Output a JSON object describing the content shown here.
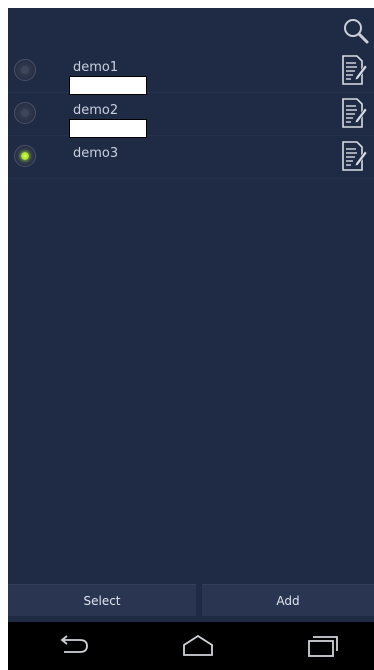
{
  "toolbar": {
    "search_icon": "search-icon"
  },
  "list": {
    "items": [
      {
        "label": "demo1",
        "selected": false,
        "has_text_field": true,
        "text_field_value": ""
      },
      {
        "label": "demo2",
        "selected": false,
        "has_text_field": true,
        "text_field_value": ""
      },
      {
        "label": "demo3",
        "selected": true,
        "has_text_field": false
      }
    ],
    "edit_icon": "edit-document-icon",
    "radio_selected_color": "#a7e02a"
  },
  "actions": {
    "select_label": "Select",
    "add_label": "Add"
  },
  "navbar": {
    "back_icon": "back-icon",
    "home_icon": "home-icon",
    "recent_icon": "recent-apps-icon"
  },
  "colors": {
    "background": "#1f2b45",
    "navbar": "#000000",
    "text": "#c7cedd"
  }
}
